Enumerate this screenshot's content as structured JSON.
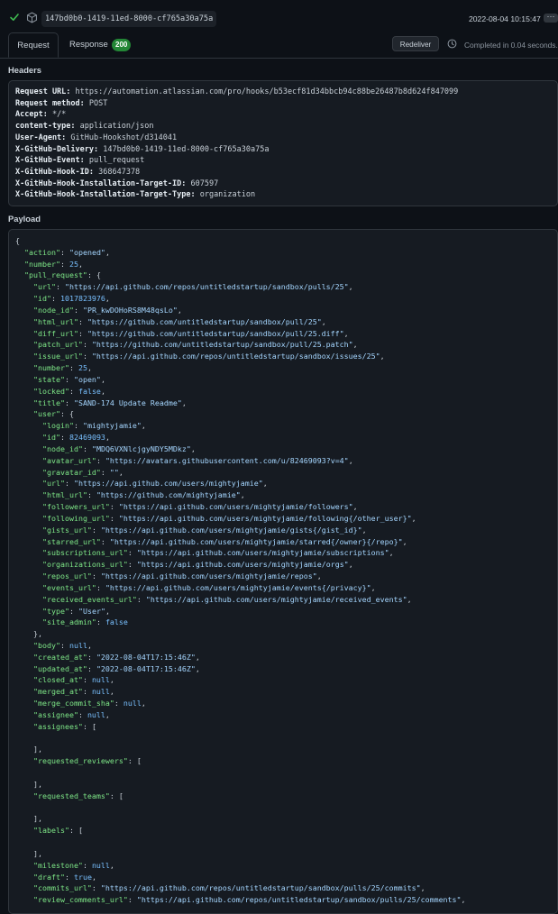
{
  "top": {
    "delivery_guid": "147bd0b0-1419-11ed-8000-cf765a30a75a",
    "timestamp": "2022-08-04 10:15:47",
    "more_label": "···"
  },
  "tabs": {
    "request_label": "Request",
    "response_label": "Response",
    "response_status": "200",
    "redeliver_label": "Redeliver",
    "completed_text": "Completed in 0.04 seconds."
  },
  "headers": {
    "title": "Headers",
    "lines": [
      {
        "key": "Request URL:",
        "value": " https://automation.atlassian.com/pro/hooks/b53ecf81d34bbcb94c88be26487b8d624f847099"
      },
      {
        "key": "Request method:",
        "value": " POST"
      },
      {
        "key": "Accept:",
        "value": " */*"
      },
      {
        "key": "content-type:",
        "value": " application/json"
      },
      {
        "key": "User-Agent:",
        "value": " GitHub-Hookshot/d314041"
      },
      {
        "key": "X-GitHub-Delivery:",
        "value": " 147bd0b0-1419-11ed-8000-cf765a30a75a"
      },
      {
        "key": "X-GitHub-Event:",
        "value": " pull_request"
      },
      {
        "key": "X-GitHub-Hook-ID:",
        "value": " 368647378"
      },
      {
        "key": "X-GitHub-Hook-Installation-Target-ID:",
        "value": " 607597"
      },
      {
        "key": "X-GitHub-Hook-Installation-Target-Type:",
        "value": " organization"
      }
    ]
  },
  "payload": {
    "title": "Payload",
    "lines": [
      {
        "indent": "",
        "key": "",
        "value": "{",
        "vtype": "p",
        "trail": ""
      },
      {
        "indent": "  ",
        "key": "\"action\"",
        "value": "\"opened\"",
        "vtype": "s",
        "trail": ","
      },
      {
        "indent": "  ",
        "key": "\"number\"",
        "value": "25",
        "vtype": "n",
        "trail": ","
      },
      {
        "indent": "  ",
        "key": "\"pull_request\"",
        "value": "{",
        "vtype": "p",
        "trail": ""
      },
      {
        "indent": "    ",
        "key": "\"url\"",
        "value": "\"https://api.github.com/repos/untitledstartup/sandbox/pulls/25\"",
        "vtype": "s",
        "trail": ","
      },
      {
        "indent": "    ",
        "key": "\"id\"",
        "value": "1017823976",
        "vtype": "n",
        "trail": ","
      },
      {
        "indent": "    ",
        "key": "\"node_id\"",
        "value": "\"PR_kwDOHoRS8M48qsLo\"",
        "vtype": "s",
        "trail": ","
      },
      {
        "indent": "    ",
        "key": "\"html_url\"",
        "value": "\"https://github.com/untitledstartup/sandbox/pull/25\"",
        "vtype": "s",
        "trail": ","
      },
      {
        "indent": "    ",
        "key": "\"diff_url\"",
        "value": "\"https://github.com/untitledstartup/sandbox/pull/25.diff\"",
        "vtype": "s",
        "trail": ","
      },
      {
        "indent": "    ",
        "key": "\"patch_url\"",
        "value": "\"https://github.com/untitledstartup/sandbox/pull/25.patch\"",
        "vtype": "s",
        "trail": ","
      },
      {
        "indent": "    ",
        "key": "\"issue_url\"",
        "value": "\"https://api.github.com/repos/untitledstartup/sandbox/issues/25\"",
        "vtype": "s",
        "trail": ","
      },
      {
        "indent": "    ",
        "key": "\"number\"",
        "value": "25",
        "vtype": "n",
        "trail": ","
      },
      {
        "indent": "    ",
        "key": "\"state\"",
        "value": "\"open\"",
        "vtype": "s",
        "trail": ","
      },
      {
        "indent": "    ",
        "key": "\"locked\"",
        "value": "false",
        "vtype": "c",
        "trail": ","
      },
      {
        "indent": "    ",
        "key": "\"title\"",
        "value": "\"SAND-174 Update Readme\"",
        "vtype": "s",
        "trail": ","
      },
      {
        "indent": "    ",
        "key": "\"user\"",
        "value": "{",
        "vtype": "p",
        "trail": ""
      },
      {
        "indent": "      ",
        "key": "\"login\"",
        "value": "\"mightyjamie\"",
        "vtype": "s",
        "trail": ","
      },
      {
        "indent": "      ",
        "key": "\"id\"",
        "value": "82469093",
        "vtype": "n",
        "trail": ","
      },
      {
        "indent": "      ",
        "key": "\"node_id\"",
        "value": "\"MDQ6VXNlcjgyNDY5MDkz\"",
        "vtype": "s",
        "trail": ","
      },
      {
        "indent": "      ",
        "key": "\"avatar_url\"",
        "value": "\"https://avatars.githubusercontent.com/u/82469093?v=4\"",
        "vtype": "s",
        "trail": ","
      },
      {
        "indent": "      ",
        "key": "\"gravatar_id\"",
        "value": "\"\"",
        "vtype": "s",
        "trail": ","
      },
      {
        "indent": "      ",
        "key": "\"url\"",
        "value": "\"https://api.github.com/users/mightyjamie\"",
        "vtype": "s",
        "trail": ","
      },
      {
        "indent": "      ",
        "key": "\"html_url\"",
        "value": "\"https://github.com/mightyjamie\"",
        "vtype": "s",
        "trail": ","
      },
      {
        "indent": "      ",
        "key": "\"followers_url\"",
        "value": "\"https://api.github.com/users/mightyjamie/followers\"",
        "vtype": "s",
        "trail": ","
      },
      {
        "indent": "      ",
        "key": "\"following_url\"",
        "value": "\"https://api.github.com/users/mightyjamie/following{/other_user}\"",
        "vtype": "s",
        "trail": ","
      },
      {
        "indent": "      ",
        "key": "\"gists_url\"",
        "value": "\"https://api.github.com/users/mightyjamie/gists{/gist_id}\"",
        "vtype": "s",
        "trail": ","
      },
      {
        "indent": "      ",
        "key": "\"starred_url\"",
        "value": "\"https://api.github.com/users/mightyjamie/starred{/owner}{/repo}\"",
        "vtype": "s",
        "trail": ","
      },
      {
        "indent": "      ",
        "key": "\"subscriptions_url\"",
        "value": "\"https://api.github.com/users/mightyjamie/subscriptions\"",
        "vtype": "s",
        "trail": ","
      },
      {
        "indent": "      ",
        "key": "\"organizations_url\"",
        "value": "\"https://api.github.com/users/mightyjamie/orgs\"",
        "vtype": "s",
        "trail": ","
      },
      {
        "indent": "      ",
        "key": "\"repos_url\"",
        "value": "\"https://api.github.com/users/mightyjamie/repos\"",
        "vtype": "s",
        "trail": ","
      },
      {
        "indent": "      ",
        "key": "\"events_url\"",
        "value": "\"https://api.github.com/users/mightyjamie/events{/privacy}\"",
        "vtype": "s",
        "trail": ","
      },
      {
        "indent": "      ",
        "key": "\"received_events_url\"",
        "value": "\"https://api.github.com/users/mightyjamie/received_events\"",
        "vtype": "s",
        "trail": ","
      },
      {
        "indent": "      ",
        "key": "\"type\"",
        "value": "\"User\"",
        "vtype": "s",
        "trail": ","
      },
      {
        "indent": "      ",
        "key": "\"site_admin\"",
        "value": "false",
        "vtype": "c",
        "trail": ""
      },
      {
        "indent": "    ",
        "key": "",
        "value": "}",
        "vtype": "p",
        "trail": ","
      },
      {
        "indent": "    ",
        "key": "\"body\"",
        "value": "null",
        "vtype": "c",
        "trail": ","
      },
      {
        "indent": "    ",
        "key": "\"created_at\"",
        "value": "\"2022-08-04T17:15:46Z\"",
        "vtype": "s",
        "trail": ","
      },
      {
        "indent": "    ",
        "key": "\"updated_at\"",
        "value": "\"2022-08-04T17:15:46Z\"",
        "vtype": "s",
        "trail": ","
      },
      {
        "indent": "    ",
        "key": "\"closed_at\"",
        "value": "null",
        "vtype": "c",
        "trail": ","
      },
      {
        "indent": "    ",
        "key": "\"merged_at\"",
        "value": "null",
        "vtype": "c",
        "trail": ","
      },
      {
        "indent": "    ",
        "key": "\"merge_commit_sha\"",
        "value": "null",
        "vtype": "c",
        "trail": ","
      },
      {
        "indent": "    ",
        "key": "\"assignee\"",
        "value": "null",
        "vtype": "c",
        "trail": ","
      },
      {
        "indent": "    ",
        "key": "\"assignees\"",
        "value": "[",
        "vtype": "p",
        "trail": ""
      },
      {
        "indent": "",
        "key": "",
        "value": "",
        "vtype": "p",
        "trail": ""
      },
      {
        "indent": "    ",
        "key": "",
        "value": "]",
        "vtype": "p",
        "trail": ","
      },
      {
        "indent": "    ",
        "key": "\"requested_reviewers\"",
        "value": "[",
        "vtype": "p",
        "trail": ""
      },
      {
        "indent": "",
        "key": "",
        "value": "",
        "vtype": "p",
        "trail": ""
      },
      {
        "indent": "    ",
        "key": "",
        "value": "]",
        "vtype": "p",
        "trail": ","
      },
      {
        "indent": "    ",
        "key": "\"requested_teams\"",
        "value": "[",
        "vtype": "p",
        "trail": ""
      },
      {
        "indent": "",
        "key": "",
        "value": "",
        "vtype": "p",
        "trail": ""
      },
      {
        "indent": "    ",
        "key": "",
        "value": "]",
        "vtype": "p",
        "trail": ","
      },
      {
        "indent": "    ",
        "key": "\"labels\"",
        "value": "[",
        "vtype": "p",
        "trail": ""
      },
      {
        "indent": "",
        "key": "",
        "value": "",
        "vtype": "p",
        "trail": ""
      },
      {
        "indent": "    ",
        "key": "",
        "value": "]",
        "vtype": "p",
        "trail": ","
      },
      {
        "indent": "    ",
        "key": "\"milestone\"",
        "value": "null",
        "vtype": "c",
        "trail": ","
      },
      {
        "indent": "    ",
        "key": "\"draft\"",
        "value": "true",
        "vtype": "c",
        "trail": ","
      },
      {
        "indent": "    ",
        "key": "\"commits_url\"",
        "value": "\"https://api.github.com/repos/untitledstartup/sandbox/pulls/25/commits\"",
        "vtype": "s",
        "trail": ","
      },
      {
        "indent": "    ",
        "key": "\"review_comments_url\"",
        "value": "\"https://api.github.com/repos/untitledstartup/sandbox/pulls/25/comments\"",
        "vtype": "s",
        "trail": ","
      }
    ]
  },
  "colors": {
    "background": "#0d1117",
    "code_bg": "#161b22",
    "border": "#30363d",
    "key": "#7ee787",
    "string": "#a5d6ff",
    "number": "#79c0ff",
    "success": "#238636"
  }
}
